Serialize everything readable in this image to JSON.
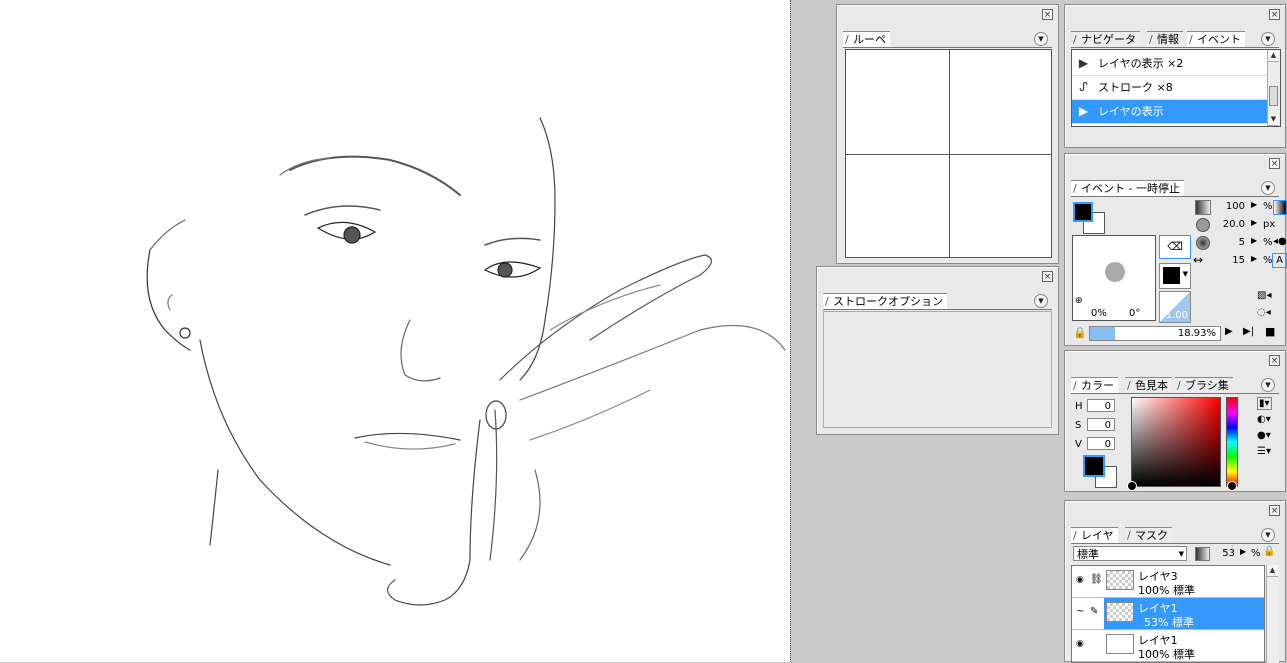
{
  "loupe": {
    "title": "ルーペ"
  },
  "stroke_options": {
    "title": "ストロークオプション"
  },
  "navigator": {
    "tabs": [
      "ナビゲータ",
      "情報",
      "イベント"
    ],
    "events": [
      {
        "icon": "layer-visibility-icon",
        "label": "レイヤの表示 ×2",
        "selected": false
      },
      {
        "icon": "stroke-icon",
        "label": "ストローク ×8",
        "selected": false
      },
      {
        "icon": "layer-visibility-icon",
        "label": "レイヤの表示",
        "selected": true
      }
    ]
  },
  "brush": {
    "tab": "イベント - 一時停止",
    "opacity": "100",
    "opacity_unit": "%",
    "size": "20.0",
    "size_unit": "px",
    "hardness": "5",
    "hardness_unit": "%",
    "spacing": "15",
    "spacing_unit": "%",
    "preview_pct": "0%",
    "preview_angle": "0°",
    "ratio": "1.00",
    "progress": "18.93%"
  },
  "color": {
    "tabs": [
      "カラー",
      "色見本",
      "ブラシ集"
    ],
    "h_label": "H",
    "h": "0",
    "s_label": "S",
    "s": "0",
    "v_label": "V",
    "v": "0",
    "hue_color": "#ff0000",
    "foreground": "#000000"
  },
  "layers": {
    "tabs": [
      "レイヤ",
      "マスク"
    ],
    "blend_mode": "標準",
    "opacity": "53",
    "opacity_unit": "%",
    "rows": [
      {
        "name": "レイヤ3",
        "info": "100% 標準",
        "selected": false
      },
      {
        "name": "レイヤ1",
        "info": "53% 標準",
        "selected": true
      },
      {
        "name": "レイヤ1",
        "info": "100% 標準",
        "selected": false
      }
    ]
  }
}
